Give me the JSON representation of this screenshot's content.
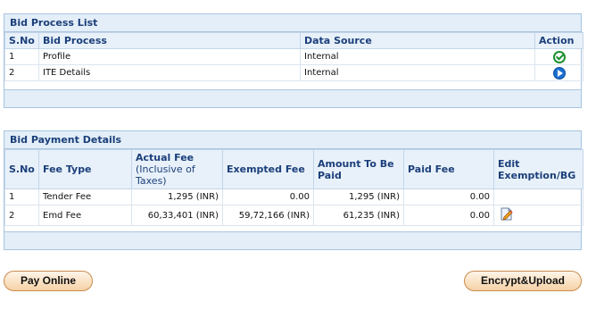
{
  "bid_process": {
    "title": "Bid Process List",
    "headers": {
      "sno": "S.No",
      "process": "Bid Process",
      "source": "Data Source",
      "action": "Action"
    },
    "rows": [
      {
        "sno": "1",
        "process": "Profile",
        "source": "Internal",
        "action_icon": "check-circle-icon"
      },
      {
        "sno": "2",
        "process": "ITE Details",
        "source": "Internal",
        "action_icon": "play-circle-icon"
      }
    ]
  },
  "bid_payment": {
    "title": "Bid Payment Details",
    "headers": {
      "sno": "S.No",
      "fee_type": "Fee Type",
      "actual_fee": "Actual Fee",
      "actual_fee_note": "(Inclusive of Taxes)",
      "exempted_fee": "Exempted Fee",
      "amount_to_be_paid": "Amount To Be Paid",
      "paid_fee": "Paid Fee",
      "edit": "Edit Exemption/BG"
    },
    "rows": [
      {
        "sno": "1",
        "fee_type": "Tender Fee",
        "actual_fee": "1,295 (INR)",
        "exempted_fee": "0.00",
        "amount_to_be_paid": "1,295 (INR)",
        "paid_fee": "0.00",
        "edit_icon": ""
      },
      {
        "sno": "2",
        "fee_type": "Emd Fee",
        "actual_fee": "60,33,401 (INR)",
        "exempted_fee": "59,72,166 (INR)",
        "amount_to_be_paid": "61,235 (INR)",
        "paid_fee": "0.00",
        "edit_icon": "edit-document-icon"
      }
    ]
  },
  "buttons": {
    "pay_online": "Pay Online",
    "encrypt_upload": "Encrypt&Upload"
  },
  "colors": {
    "panel_header": "#e3eef8",
    "title_text": "#1b3f7a",
    "button_border": "#c98c4e",
    "ok_green": "#1f8f2f",
    "play_blue": "#1c6fd1"
  }
}
